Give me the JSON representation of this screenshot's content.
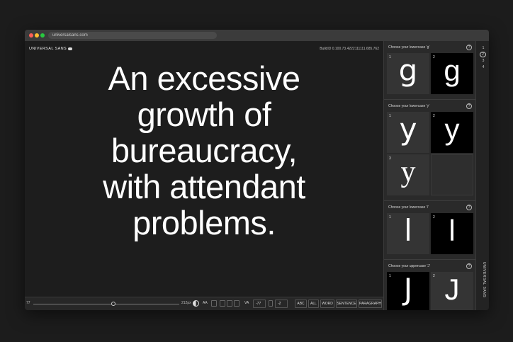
{
  "browser": {
    "url": "universalsans.com"
  },
  "header": {
    "brand": "UNIVERSAL SANS",
    "build_id": "BuildID 0.100.73.4222111111.685.762"
  },
  "specimen": {
    "lines": [
      "An excessive",
      "growth of",
      "bureaucracy,",
      "with attendant",
      "problems."
    ]
  },
  "toolbar": {
    "size_value": "77",
    "size_max": "212px",
    "size_fraction": 0.55,
    "aa_label": "AA",
    "va_label": "VA",
    "tracking_value": "-77",
    "leading_value": "-2",
    "buttons": [
      "ABC",
      "ALL",
      "WORD",
      "SENTENCE",
      "PARAGRAPH"
    ]
  },
  "sidebar": {
    "sections": [
      {
        "title": "Choose your lowercase 'g'",
        "help": "?",
        "options": [
          {
            "num": "1",
            "glyph": "g"
          },
          {
            "num": "2",
            "glyph": "g"
          }
        ]
      },
      {
        "title": "Choose your lowercase 'y'",
        "help": "?",
        "options": [
          {
            "num": "1",
            "glyph": "y"
          },
          {
            "num": "2",
            "glyph": "y"
          },
          {
            "num": "3",
            "glyph": "y"
          }
        ]
      },
      {
        "title": "Choose your lowercase 'l'",
        "help": "?",
        "options": [
          {
            "num": "1",
            "glyph": "l"
          },
          {
            "num": "2",
            "glyph": "l"
          }
        ]
      },
      {
        "title": "Choose your uppercase 'J'",
        "help": "?",
        "options": [
          {
            "num": "1",
            "glyph": "J"
          },
          {
            "num": "2",
            "glyph": "J"
          }
        ]
      }
    ]
  },
  "rail": {
    "steps": [
      "1",
      "2",
      "3",
      "4"
    ],
    "vertical_label": "UNIVERSAL SANS"
  }
}
